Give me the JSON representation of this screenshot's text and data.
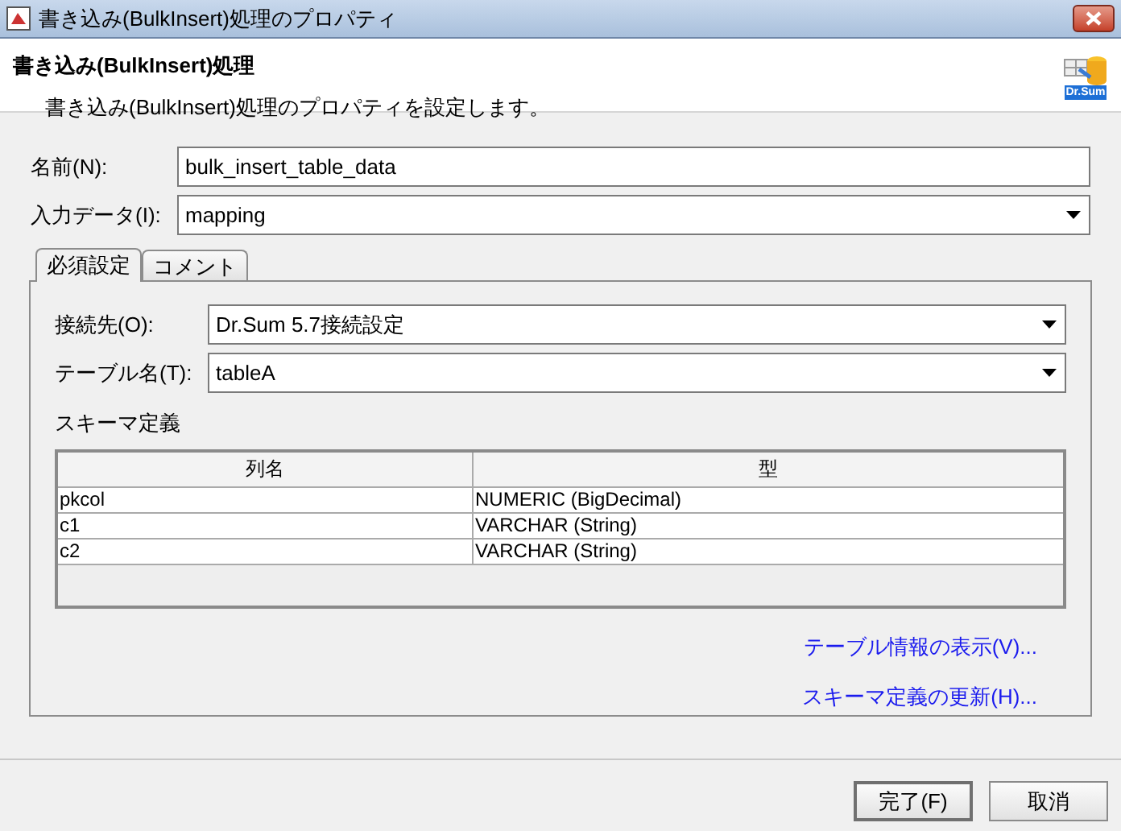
{
  "window": {
    "title": "書き込み(BulkInsert)処理のプロパティ"
  },
  "header": {
    "title": "書き込み(BulkInsert)処理",
    "description": "書き込み(BulkInsert)処理のプロパティを設定します。",
    "logo_text": "Dr.Sum"
  },
  "fields": [
    {
      "kind": "text",
      "label": "名前(N):",
      "value": "bulk_insert_table_data"
    },
    {
      "kind": "select",
      "label": "入力データ(I):",
      "value": "mapping"
    }
  ],
  "tabs": [
    {
      "label": "必須設定",
      "selected": true
    },
    {
      "label": "コメント",
      "selected": false
    }
  ],
  "panel": {
    "fields": [
      {
        "kind": "select",
        "label": "接続先(O):",
        "value": "Dr.Sum 5.7接続設定"
      },
      {
        "kind": "select",
        "label": "テーブル名(T):",
        "value": "tableA"
      }
    ],
    "schema_label": "スキーマ定義",
    "table": {
      "columns": [
        "列名",
        "型"
      ],
      "rows": [
        [
          "pkcol",
          "NUMERIC (BigDecimal)"
        ],
        [
          "c1",
          "VARCHAR (String)"
        ],
        [
          "c2",
          "VARCHAR (String)"
        ]
      ]
    },
    "links": [
      "テーブル情報の表示(V)...",
      "スキーマ定義の更新(H)..."
    ]
  },
  "buttons": [
    {
      "label": "完了(F)",
      "default": true
    },
    {
      "label": "取消",
      "default": false
    }
  ]
}
